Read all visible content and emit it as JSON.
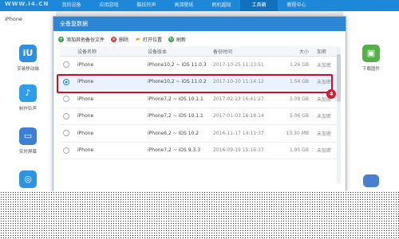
{
  "app": {
    "logo_text": "WWW.I4.CN"
  },
  "topnav": {
    "tabs": [
      {
        "label": "我的设备"
      },
      {
        "label": "应用游戏"
      },
      {
        "label": "酷炫铃声"
      },
      {
        "label": "高清壁纸"
      },
      {
        "label": "刷机越狱"
      },
      {
        "label": "工具箱",
        "active": true
      },
      {
        "label": "教程中心"
      }
    ]
  },
  "left_panel": {
    "device_name": "iPhone",
    "tiles": [
      {
        "label": "安装移动端",
        "icon": "i4-app-icon",
        "glyph": "iU"
      },
      {
        "label": "制作铃声",
        "icon": "bell-icon",
        "glyph": "♪"
      },
      {
        "label": "实时屏幕",
        "icon": "monitor-icon",
        "glyph": "▭"
      },
      {
        "label": "",
        "icon": "compass-icon",
        "glyph": "◎"
      }
    ]
  },
  "right_panel": {
    "tiles": [
      {
        "label": "下载固件",
        "icon": "box-icon",
        "glyph": "▣"
      }
    ]
  },
  "dialog": {
    "title": "全备复数据",
    "toolbar": {
      "add_label": "添加其他备份文件",
      "delete_label": "删除",
      "open_location_label": "打开位置",
      "refresh_label": "刷新"
    },
    "columns": [
      "设备名称",
      "设备版本",
      "备份时间",
      "大小",
      "加密"
    ],
    "rows": [
      {
        "name": "iPhone",
        "version": "iPhone10,2 ~ iOS 11.0.3",
        "time": "2017-10-25 11:23:51",
        "size": "1.26 GB",
        "encrypted": "未加密",
        "checked": false
      },
      {
        "name": "iPhone",
        "version": "iPhone10,2 ~ iOS 11.0.2",
        "time": "2017-10-10 11:14:12",
        "size": "1.54 GB",
        "encrypted": "未加密",
        "checked": true
      },
      {
        "name": "iPhone",
        "version": "iPhone7,2 ~ iOS 10.1.1",
        "time": "2017-02-23 16:41:27",
        "size": "5.09 GB",
        "encrypted": "未加密",
        "checked": false
      },
      {
        "name": "iPhone",
        "version": "iPhone7,2 ~ iOS 10.1.1",
        "time": "2017-01-03 16:18:14",
        "size": "5.06 GB",
        "encrypted": "未加密",
        "checked": false
      },
      {
        "name": "iPhone",
        "version": "iPhone6,2 ~ iOS 10.2",
        "time": "2016-11-17 14:11:37",
        "size": "13.30 MB",
        "encrypted": "未加密",
        "checked": false
      },
      {
        "name": "iPhone",
        "version": "iPhone7,2 ~ iOS 9.3.3",
        "time": "2016-09-19 15:16:37",
        "size": "1.95 GB",
        "encrypted": "未加密",
        "checked": false
      }
    ],
    "step_badge": "4"
  },
  "colors": {
    "accent": "#1e88d8",
    "highlight": "#c8102e"
  }
}
